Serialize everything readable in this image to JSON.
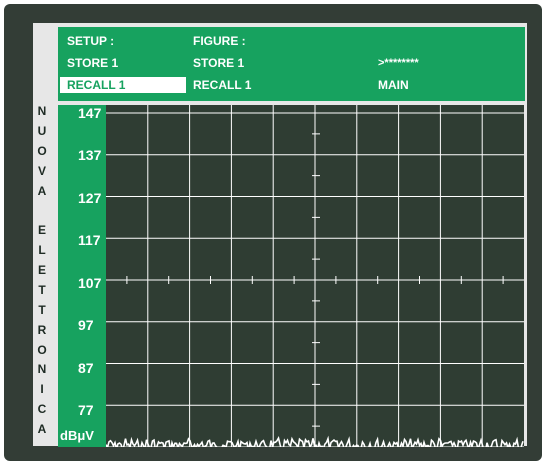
{
  "brand_vertical": [
    "N",
    "U",
    "O",
    "V",
    "A",
    "",
    "E",
    "L",
    "E",
    "T",
    "T",
    "R",
    "O",
    "N",
    "I",
    "C",
    "A"
  ],
  "menu": {
    "setup_label": "SETUP :",
    "setup_store": "STORE 1",
    "setup_recall": "RECALL 1",
    "figure_label": "FIGURE :",
    "figure_store": "STORE 1",
    "figure_recall": "RECALL 1",
    "password": ">********",
    "main": "MAIN"
  },
  "chart_data": {
    "type": "line",
    "y_ticks": [
      "147",
      "137",
      "127",
      "117",
      "107",
      "97",
      "87",
      "77"
    ],
    "ylabel": "dBμV",
    "ylim": [
      74,
      153
    ],
    "x_divisions": 10,
    "y_divisions": 8,
    "grid": true,
    "series": [
      {
        "level": 74.5,
        "note_visual": "noise floor trace"
      }
    ]
  },
  "colors": {
    "accent": "#17a25f",
    "plot_bg": "#2f3d33",
    "grid": "#ffffff"
  }
}
